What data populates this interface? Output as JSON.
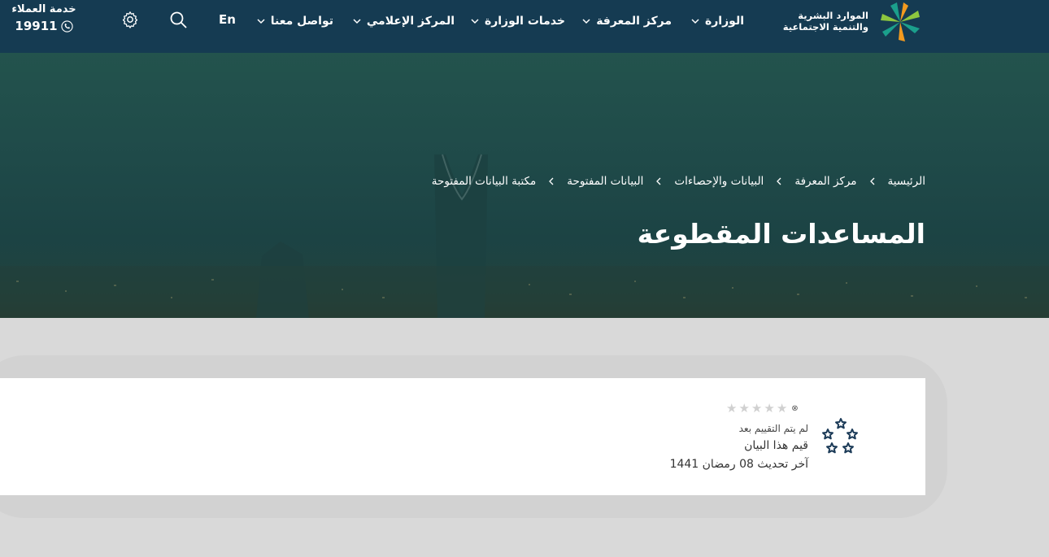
{
  "header": {
    "logo_text_line1": "الموارد البشرية",
    "logo_text_line2": "والتنمية الاجتماعية",
    "nav": [
      {
        "label": "الوزارة"
      },
      {
        "label": "مركز المعرفة"
      },
      {
        "label": "خدمات الوزارة"
      },
      {
        "label": "المركز الإعلامي"
      },
      {
        "label": "تواصل معنا"
      }
    ],
    "language_label": "En",
    "customer_service_label": "خدمة العملاء",
    "customer_service_number": "19911"
  },
  "hero": {
    "breadcrumb": [
      "الرئيسية",
      "مركز المعرفة",
      "البيانات والإحصاءات",
      "البيانات المفتوحة",
      "مكتبة البيانات المفتوحة"
    ],
    "title": "المساعدات المقطوعة"
  },
  "dataset_card": {
    "rating_stars": 0,
    "rating_max": 5,
    "no_rating_text": "لم يتم التقييم بعد",
    "rate_prompt": "قيم هذا البيان",
    "last_update": "آخر تحديث 08 رمضان 1441"
  },
  "colors": {
    "header_bg": "#153b52",
    "hero_bg": "#1f4a49",
    "page_bg": "#d9d9d9",
    "star_empty": "#d0d0d0",
    "icon_navy": "#1b3a57"
  }
}
